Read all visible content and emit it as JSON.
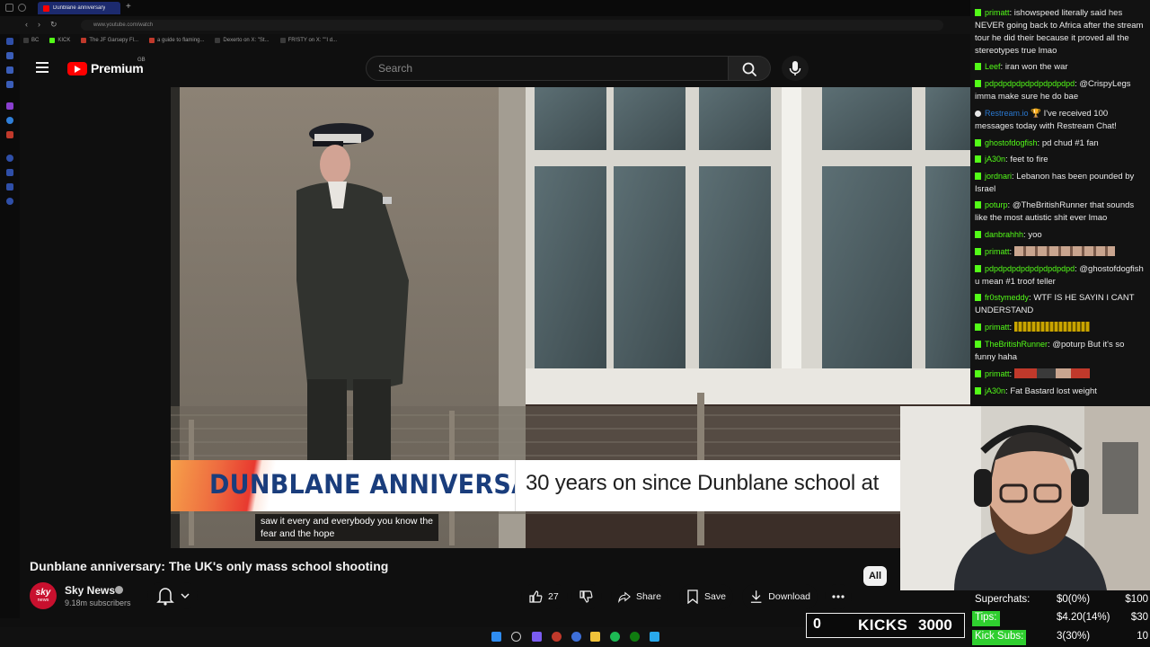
{
  "browser": {
    "active_tab_title": "Dunblane anniversary",
    "new_tab_glyph": "+",
    "url": "www.youtube.com/watch",
    "bookmarks": [
      "BC",
      "KICK",
      "The JF Garsepy Fl...",
      "a guide to flaming...",
      "Dexerto on X: \"St...",
      "FR!STY on X: \"\"I d..."
    ]
  },
  "header": {
    "brand": "Premium",
    "region": "GB",
    "search_placeholder": "Search"
  },
  "video": {
    "lower_third_title": "DUNBLANE ANNIVERSARY",
    "lower_third_sub": "30 years on since Dunblane school at",
    "captions": [
      "saw it every and everybody you know the",
      "fear and the hope"
    ],
    "title": "Dunblane anniversary: The UK's only mass school shooting"
  },
  "channel": {
    "avatar_top": "sky",
    "avatar_bottom": "news",
    "name": "Sky News",
    "subscribers": "9.18m subscribers"
  },
  "actions": {
    "likes": "27",
    "share": "Share",
    "save": "Save",
    "download": "Download",
    "filter_chip": "All"
  },
  "chat": [
    {
      "user": "primatt",
      "text": "ishowspeed literally said hes NEVER going back to Africa after the stream tour he did their because it proved all the stereotypes true lmao"
    },
    {
      "user": "Leef",
      "text": "iran won the war"
    },
    {
      "user": "pdpdpdpdpdpdpdpdpdpd",
      "text": "@CrispyLegs imma make sure he do bae"
    },
    {
      "user": "Restream.io",
      "text": "🏆 I've received 100 messages today with Restream Chat!"
    },
    {
      "user": "ghostofdogfish",
      "text": "pd chud #1 fan"
    },
    {
      "user": "jA30n",
      "text": "feet to fire"
    },
    {
      "user": "jordnari",
      "text": "Lebanon has been pounded by Israel"
    },
    {
      "user": "poturp",
      "text": "@TheBritishRunner that sounds like the most autistic shit ever lmao"
    },
    {
      "user": "danbrahhh",
      "text": "yoo"
    },
    {
      "user": "primatt",
      "text": ""
    },
    {
      "user": "pdpdpdpdpdpdpdpdpdpd",
      "text": "@ghostofdogfish u mean #1 troof teller"
    },
    {
      "user": "fr0stymeddy",
      "text": "WTF IS HE SAYIN I CANT UNDERSTAND"
    },
    {
      "user": "primatt",
      "text": ""
    },
    {
      "user": "TheBritishRunner",
      "text": "@poturp But it's so funny haha"
    },
    {
      "user": "primatt",
      "text": ""
    },
    {
      "user": "jA30n",
      "text": "Fat Bastard lost weight"
    }
  ],
  "kicks_goal": {
    "current": "0",
    "label": "KICKS",
    "target": "3000"
  },
  "donations": [
    {
      "label": "Superchats:",
      "value": "$0(0%)",
      "goal": "$100",
      "color": "#0d0d0d"
    },
    {
      "label": "Tips:",
      "value": "$4.20(14%)",
      "goal": "$30",
      "color": "#2fcf2f",
      "progress": 0.14
    },
    {
      "label": "Kick Subs:",
      "value": "3(30%)",
      "goal": "10",
      "color": "#2fcf2f",
      "progress": 0.3
    }
  ],
  "colors": {
    "yt_red": "#ff0000",
    "kick_green": "#53fc18",
    "lower_third_blue": "#1a3d7c"
  }
}
